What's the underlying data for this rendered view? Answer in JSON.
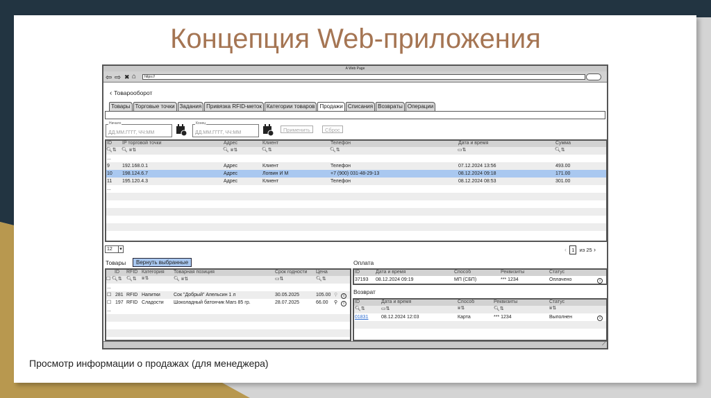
{
  "slide": {
    "title": "Концепция Web-приложения",
    "caption": "Просмотр информации о продажах (для менеджера)",
    "colors": {
      "title": "#a57553",
      "dark": "#223441",
      "gold": "#b8984f",
      "selected_row": "#a9c8f0"
    }
  },
  "browser": {
    "title": "A Web Page",
    "url": "https://",
    "icons": [
      "back-arrow-icon",
      "forward-arrow-icon",
      "close-icon",
      "home-icon"
    ]
  },
  "app": {
    "back_label": "Товарооборот",
    "tabs": [
      {
        "label": "Товары"
      },
      {
        "label": "Торговые точки"
      },
      {
        "label": "Задания"
      },
      {
        "label": "Привязка RFID-меток"
      },
      {
        "label": "Категории товаров"
      },
      {
        "label": "Продажи",
        "active": true
      },
      {
        "label": "Списания"
      },
      {
        "label": "Возвраты"
      },
      {
        "label": "Операции"
      }
    ],
    "filters": {
      "start_label": "Начало",
      "start_placeholder": "ДД.ММ.ГГГГ, ЧЧ:ММ",
      "end_label": "Конец",
      "end_placeholder": "ДД.ММ.ГГГГ, ЧЧ:ММ",
      "apply": "Применить",
      "reset": "Сброс"
    },
    "sales": {
      "columns": [
        "ID",
        "IP торговой точки",
        "Адрес",
        "Клиент",
        "Телефон",
        "Дата и время",
        "Сумма"
      ],
      "ellipsis": "...",
      "rows": [
        {
          "id": "9",
          "ip": "192.168.0.1",
          "address": "Адрес",
          "client": "Клиент",
          "phone": "Телефон",
          "datetime": "07.12.2024 13:56",
          "sum": "493.00"
        },
        {
          "id": "10",
          "ip": "198.124.6.7",
          "address": "Адрес",
          "client": "Логвин И М",
          "phone": "+7 (900) 031-48-29-13",
          "datetime": "08.12.2024 09:18",
          "sum": "171.00",
          "selected": true
        },
        {
          "id": "11",
          "ip": "195.120.4.3",
          "address": "Адрес",
          "client": "Клиент",
          "phone": "Телефон",
          "datetime": "08.12.2024 08:53",
          "sum": "301.00"
        }
      ]
    },
    "page_size": "12",
    "pager": {
      "current": "1",
      "of_label": "из 25"
    },
    "goods": {
      "label": "Товары",
      "return_button": "Вернуть выбранные",
      "columns": [
        "ID",
        "RFID",
        "Категория",
        "Товарная позиция",
        "Срок годности",
        "Цена"
      ],
      "rows": [
        {
          "id": "281",
          "rfid": "RFID",
          "category": "Напитки",
          "item": "Сок \"Добрый\" Апельсин 1 л",
          "expiry": "30.05.2025",
          "price": "105.00"
        },
        {
          "id": "197",
          "rfid": "RFID",
          "category": "Сладости",
          "item": "Шоколадный батончик Mars 85 гр.",
          "expiry": "28.07.2025",
          "price": "66.00"
        }
      ]
    },
    "payment": {
      "label": "Оплата",
      "columns": [
        "ID",
        "Дата и время",
        "Способ",
        "Реквизиты",
        "Статус"
      ],
      "row": {
        "id": "37193",
        "datetime": "08.12.2024 09:19",
        "method": "МП (СБП)",
        "details": "*** 1234",
        "status": "Оплачено"
      }
    },
    "refund": {
      "label": "Возврат",
      "columns": [
        "ID",
        "Дата и время",
        "Способ",
        "Реквизиты",
        "Статус"
      ],
      "row": {
        "id": "01831",
        "datetime": "08.12.2024 12:03",
        "method": "Карта",
        "details": "*** 1234",
        "status": "Выполнен"
      }
    }
  }
}
